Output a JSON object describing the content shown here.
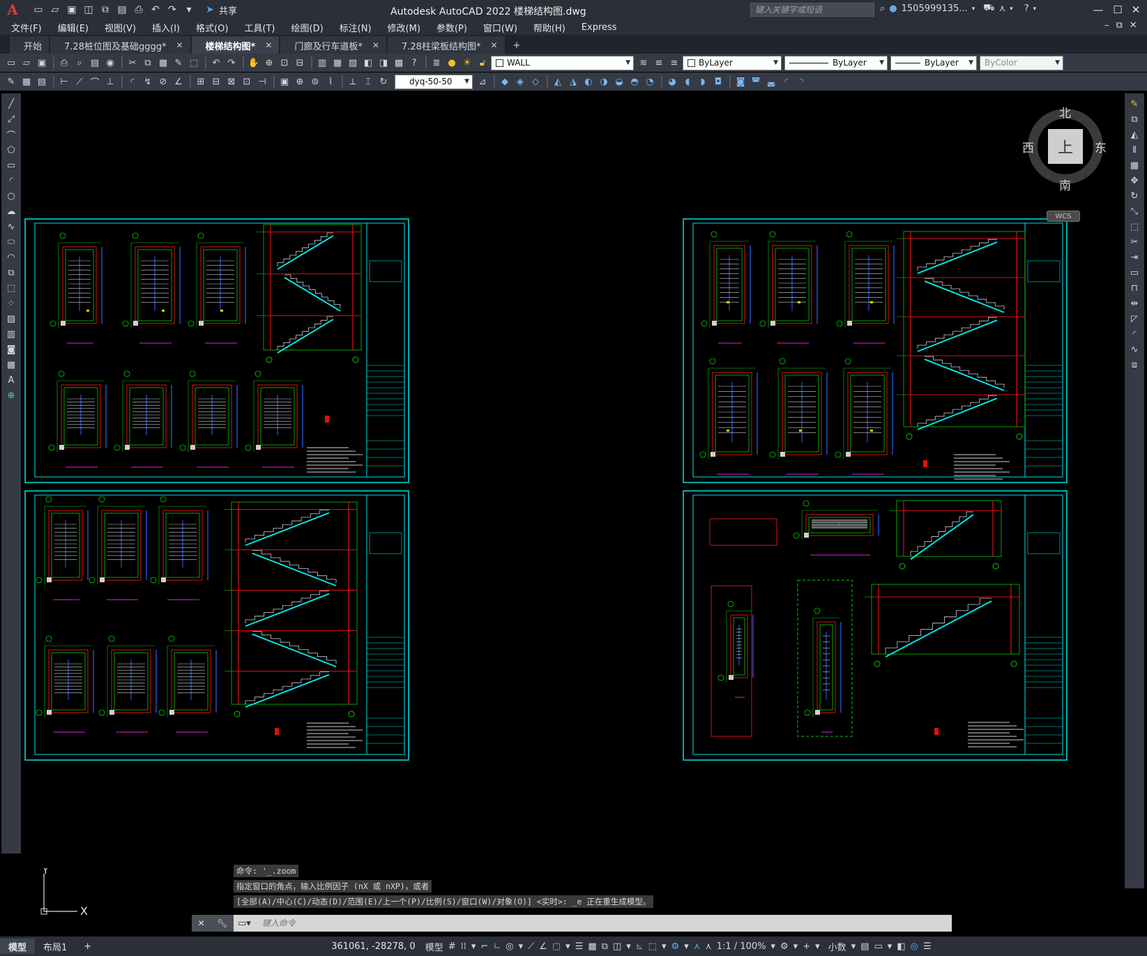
{
  "app": {
    "title": "Autodesk AutoCAD 2022    楼梯结构图.dwg",
    "logo": "A",
    "search_placeholder": "键入关键字或短语",
    "user": "1505999135...",
    "share_label": "共享"
  },
  "menu": [
    "文件(F)",
    "编辑(E)",
    "视图(V)",
    "插入(I)",
    "格式(O)",
    "工具(T)",
    "绘图(D)",
    "标注(N)",
    "修改(M)",
    "参数(P)",
    "窗口(W)",
    "帮助(H)",
    "Express"
  ],
  "tabs": [
    {
      "label": "开始",
      "closable": false,
      "active": false
    },
    {
      "label": "7.28桩位图及基础gggg*",
      "closable": true,
      "active": false
    },
    {
      "label": "楼梯结构图*",
      "closable": true,
      "active": true
    },
    {
      "label": "门廊及行车道板*",
      "closable": true,
      "active": false
    },
    {
      "label": "7.28柱梁板结构图*",
      "closable": true,
      "active": false
    }
  ],
  "toolbar": {
    "layer": "WALL",
    "color": "ByLayer",
    "linetype": "ByLayer",
    "lineweight": "ByLayer",
    "plotstyle": "ByColor",
    "dimstyle": "dyq-50-50"
  },
  "viewcube": {
    "north": "北",
    "south": "南",
    "east": "东",
    "west": "西",
    "face": "上",
    "wcs": "WCS"
  },
  "command": {
    "history": [
      "命令: '_.zoom",
      "指定窗口的角点，输入比例因子 (nX 或 nXP)，或者",
      "[全部(A)/中心(C)/动态(D)/范围(E)/上一个(P)/比例(S)/窗口(W)/对象(O)] <实时>: _e 正在重生成模型。"
    ],
    "placeholder": "键入命令"
  },
  "status": {
    "layout_tabs": [
      "模型",
      "布局1"
    ],
    "coords": "361061, -28278, 0",
    "space": "模型",
    "scale": "1:1 / 100%",
    "units": "小数"
  },
  "colors": {
    "accent": "#00e5e5",
    "bg": "#000000",
    "ui": "#2b2f38"
  },
  "icons": [
    "new-file-icon",
    "open-icon",
    "save-icon",
    "save-as-icon",
    "plot-icon",
    "undo-icon",
    "redo-icon",
    "share-icon",
    "search-icon",
    "user-icon",
    "cart-icon",
    "help-icon"
  ]
}
